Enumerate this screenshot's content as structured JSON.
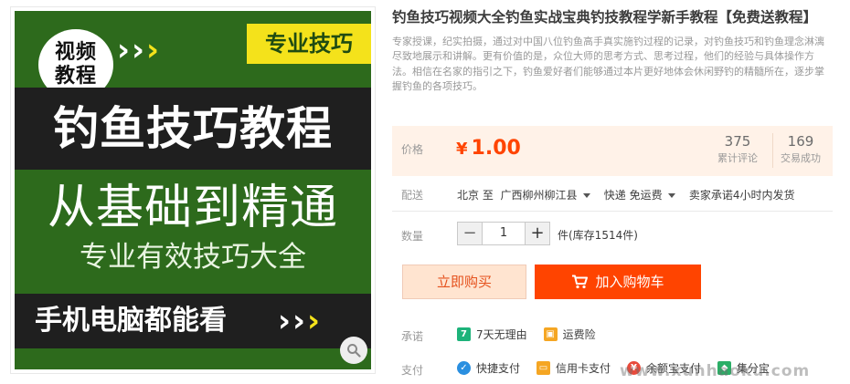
{
  "poster": {
    "badge": "视频\n教程",
    "tag": "专业技巧",
    "headline": "钓鱼技巧教程",
    "subheadline": "从基础到精通",
    "tagline": "专业有效技巧大全",
    "footer": "手机电脑都能看",
    "zoom_icon": "search-icon"
  },
  "product": {
    "title": "钓鱼技巧视频大全钓鱼实战宝典钓技教程学新手教程【免费送教程】",
    "description": "专家授课，纪实拍摄，通过对中国八位钓鱼高手真实施钓过程的记录，对钓鱼技巧和钓鱼理念淋漓尽致地展示和讲解。更有价值的是，众位大师的思考方式、思考过程，他们的经验与具体操作方法。相信在名家的指引之下，钓鱼爱好者们能够通过本片更好地体会休闲野钓的精髓所在，逐步掌握钓鱼的各项技巧。"
  },
  "price": {
    "label": "价格",
    "currency": "¥",
    "value": "1.00",
    "reviews_count": "375",
    "reviews_label": "累计评论",
    "sales_count": "169",
    "sales_label": "交易成功"
  },
  "shipping": {
    "label": "配送",
    "from": "北京",
    "to_word": "至",
    "destination": "广西柳州柳江县",
    "method": "快递 免运费",
    "promise": "卖家承诺4小时内发货"
  },
  "quantity": {
    "label": "数量",
    "value": "1",
    "minus": "−",
    "plus": "+",
    "stock": "件(库存1514件)"
  },
  "buttons": {
    "buy_now": "立即购买",
    "add_to_cart": "加入购物车"
  },
  "promise": {
    "label": "承诺",
    "items": [
      "7天无理由",
      "运费险"
    ]
  },
  "payment": {
    "label": "支付",
    "items": [
      "快捷支付",
      "信用卡支付",
      "余额宝支付",
      "集分宝"
    ]
  },
  "watermark": "www.xunhaoku.com",
  "colors": {
    "accent": "#ff4400",
    "poster_green": "#2d6a1c",
    "poster_yellow": "#f4e21b",
    "price_bg": "#fff2e8"
  }
}
